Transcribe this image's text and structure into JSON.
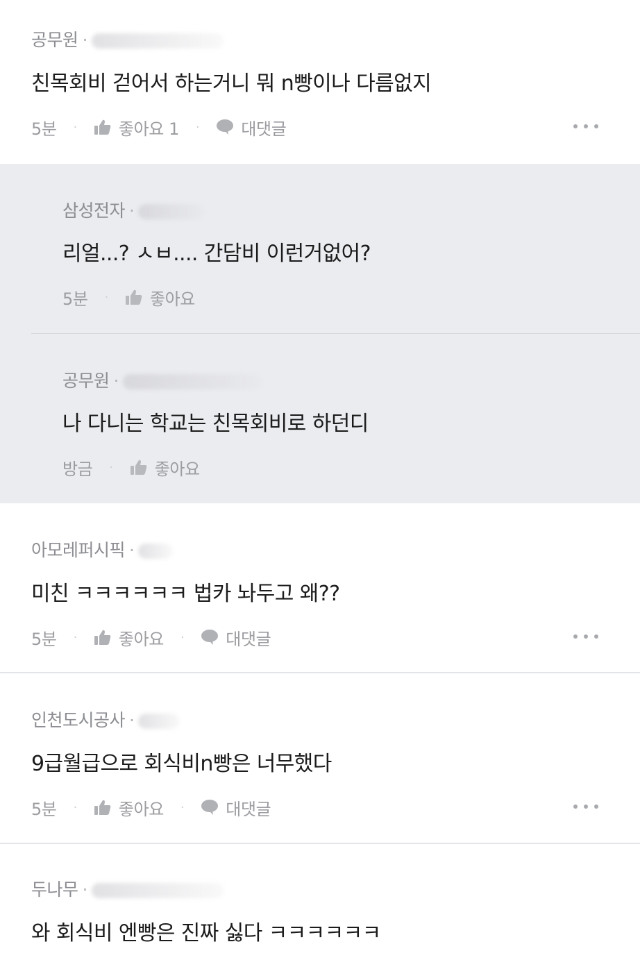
{
  "comments": [
    {
      "author": "공무원",
      "text": "친목회비 걷어서 하는거니 뭐 n빵이나 다름없지",
      "time": "5분",
      "like_label": "좋아요 1",
      "reply_label": "대댓글"
    },
    {
      "author": "아모레퍼시픽",
      "text": "미친 ㅋㅋㅋㅋㅋㅋ 법카 놔두고 왜??",
      "time": "5분",
      "like_label": "좋아요",
      "reply_label": "대댓글"
    },
    {
      "author": "인천도시공사",
      "text": "9급월급으로 회식비n빵은 너무했다",
      "time": "5분",
      "like_label": "좋아요",
      "reply_label": "대댓글"
    },
    {
      "author": "두나무",
      "text": "와 회식비 엔빵은 진짜 싫다 ㅋㅋㅋㅋㅋㅋ"
    }
  ],
  "replies": [
    {
      "author": "삼성전자",
      "text": "리얼...? ㅅㅂ.... 간담비 이런거없어?",
      "time": "5분",
      "like_label": "좋아요"
    },
    {
      "author": "공무원",
      "text": "나 다니는 학교는 친목회비로 하던디",
      "time": "방금",
      "like_label": "좋아요"
    }
  ],
  "separator": "·",
  "icons": {
    "like": "thumbs-up-icon",
    "reply": "speech-bubble-icon",
    "more": "more-dots-icon"
  },
  "colors": {
    "reply_background": "#ebecf0",
    "meta": "#8c8d92",
    "text": "#1b1b1b"
  }
}
